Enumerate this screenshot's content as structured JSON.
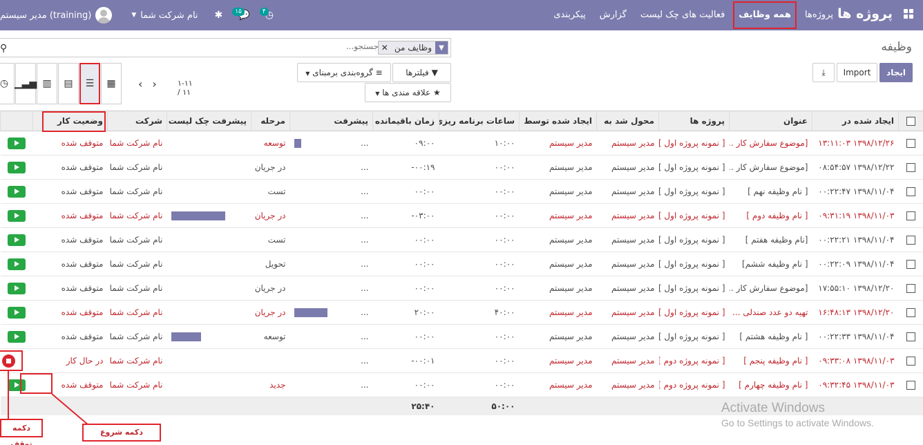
{
  "navbar": {
    "brand": "پروژه ها",
    "menu": [
      "پروژه‌ها",
      "همه وظایف",
      "فعالیت های چک لیست",
      "گزارش",
      "پیکربندی"
    ],
    "user": "مدیر سیستم (training)",
    "company": "نام شرکت شما",
    "activity_count": "۴",
    "message_count": "۱۵"
  },
  "control": {
    "title": "وظیفه",
    "facet": "وظایف من",
    "search_placeholder": "جستجو...",
    "create_label": "ایجاد",
    "import_label": "Import",
    "filters_label": "فیلترها",
    "groupby_label": "گروه‌بندی برمبنای",
    "favorites_label": "علاقه مندی ها",
    "pager": "۱-۱۱ / ۱۱"
  },
  "columns": [
    "ایجاد شده در",
    "عنوان",
    "پروژه ها",
    "محول شد به",
    "ایجاد شده توسط",
    "ساعات برنامه ریزی ...",
    "زمان باقیمانده",
    "پیشرفت",
    "مرحله",
    "پیشرفت چک لیست",
    "شرکت",
    "وضعیت کار"
  ],
  "rows": [
    {
      "red": true,
      "created": "۱۳۹۸/۱۲/۲۶ ۱۳:۱۱:۰۳",
      "name": "[موضوع سفارش کار ...",
      "project": "[ نمونه پروژه اول ]",
      "assigned": "مدیر سیستم",
      "creator": "مدیر سیستم",
      "planned": "۱۰:۰۰",
      "remaining": "۰۹:۰۰",
      "progress": 0.1,
      "dots": "...",
      "stage": "توسعه",
      "checklist": 0,
      "company": "نام شرکت شما",
      "status": "متوقف شده",
      "action": "play"
    },
    {
      "red": false,
      "created": "۱۳۹۸/۱۲/۲۲ ۰۸:۵۴:۵۷",
      "name": "[موضوع سفارش کار ...",
      "project": "[ نمونه پروژه اول ]",
      "assigned": "مدیر سیستم",
      "creator": "مدیر سیستم",
      "planned": "۰۰:۰۰",
      "remaining": "-۰۰:۱۹",
      "progress": 0,
      "dots": "...",
      "stage": "در جریان",
      "checklist": 0,
      "company": "نام شرکت شما",
      "status": "متوقف شده",
      "action": "play"
    },
    {
      "red": false,
      "created": "۱۳۹۸/۱۱/۰۴ ۰۰:۲۲:۴۷",
      "name": "[ نام وظیفه نهم ]",
      "project": "[ نمونه پروژه اول ]",
      "assigned": "مدیر سیستم",
      "creator": "مدیر سیستم",
      "planned": "۰۰:۰۰",
      "remaining": "۰۰:۰۰",
      "progress": 0,
      "dots": "...",
      "stage": "تست",
      "checklist": 0,
      "company": "نام شرکت شما",
      "status": "متوقف شده",
      "action": "play"
    },
    {
      "red": true,
      "created": "۱۳۹۸/۱۱/۰۳ ۰۹:۳۱:۱۹",
      "name": "[ نام وظیفه دوم ]",
      "project": "[ نمونه پروژه اول ]",
      "assigned": "مدیر سیستم",
      "creator": "مدیر سیستم",
      "planned": "۰۰:۰۰",
      "remaining": "-۰۳:۰۰",
      "progress": 0,
      "dots": "...",
      "stage": "در جریان",
      "checklist": 1,
      "company": "نام شرکت شما",
      "status": "متوقف شده",
      "action": "play"
    },
    {
      "red": false,
      "created": "۱۳۹۸/۱۱/۰۴ ۰۰:۲۲:۲۱",
      "name": "[نام وظیفه هفتم ]",
      "project": "[ نمونه پروژه اول ]",
      "assigned": "مدیر سیستم",
      "creator": "مدیر سیستم",
      "planned": "۰۰:۰۰",
      "remaining": "۰۰:۰۰",
      "progress": 0,
      "dots": "...",
      "stage": "تست",
      "checklist": 0,
      "company": "نام شرکت شما",
      "status": "متوقف شده",
      "action": "play"
    },
    {
      "red": false,
      "created": "۱۳۹۸/۱۱/۰۴ ۰۰:۲۲:۰۹",
      "name": "[ نام وظیفه ششم]",
      "project": "[ نمونه پروژه اول ]",
      "assigned": "مدیر سیستم",
      "creator": "مدیر سیستم",
      "planned": "۰۰:۰۰",
      "remaining": "۰۰:۰۰",
      "progress": 0,
      "dots": "...",
      "stage": "تحویل",
      "checklist": 0,
      "company": "نام شرکت شما",
      "status": "متوقف شده",
      "action": "play"
    },
    {
      "red": false,
      "created": "۱۳۹۸/۱۲/۲۰ ۱۷:۵۵:۱۰",
      "name": "[موضوع سفارش کار ...",
      "project": "[ نمونه پروژه اول ]",
      "assigned": "مدیر سیستم",
      "creator": "مدیر سیستم",
      "planned": "۰۰:۰۰",
      "remaining": "۰۰:۰۰",
      "progress": 0,
      "dots": "...",
      "stage": "در جریان",
      "checklist": 0,
      "company": "نام شرکت شما",
      "status": "متوقف شده",
      "action": "play"
    },
    {
      "red": true,
      "created": "۱۳۹۸/۱۲/۲۰ ۱۶:۴۸:۱۳",
      "name": "تهیه دو عدد صندلی ...",
      "project": "[ نمونه پروژه اول ]",
      "assigned": "مدیر سیستم",
      "creator": "مدیر سیستم",
      "planned": "۴۰:۰۰",
      "remaining": "۲۰:۰۰",
      "progress": 0.5,
      "dots": "...",
      "stage": "در جریان",
      "checklist": 0,
      "company": "نام شرکت شما",
      "status": "متوقف شده",
      "action": "play"
    },
    {
      "red": false,
      "created": "۱۳۹۸/۱۱/۰۴ ۰۰:۲۲:۳۳",
      "name": "[ نام وظیفه هشتم ]",
      "project": "[ نمونه پروژه اول ]",
      "assigned": "مدیر سیستم",
      "creator": "مدیر سیستم",
      "planned": "۰۰:۰۰",
      "remaining": "۰۰:۰۰",
      "progress": 0,
      "dots": "...",
      "stage": "توسعه",
      "checklist": 0.55,
      "company": "نام شرکت شما",
      "status": "متوقف شده",
      "action": "play"
    },
    {
      "red": true,
      "created": "۱۳۹۸/۱۱/۰۳ ۰۹:۳۳:۰۸",
      "name": "[ نام وظیفه پنجم ]",
      "project": "[ نمونه پروژه دوم ]",
      "assigned": "مدیر سیستم",
      "creator": "مدیر سیستم",
      "planned": "۰۰:۰۰",
      "remaining": "-۰۰:۰۱",
      "progress": 0,
      "dots": "...",
      "stage": "",
      "checklist": 0,
      "company": "نام شرکت شما",
      "status": "در حال کار",
      "action": "stop"
    },
    {
      "red": true,
      "created": "۱۳۹۸/۱۱/۰۳ ۰۹:۳۲:۴۵",
      "name": "[ نام وظیفه چهارم ]",
      "project": "[ نمونه پروژه دوم ]",
      "assigned": "مدیر سیستم",
      "creator": "مدیر سیستم",
      "planned": "۰۰:۰۰",
      "remaining": "۰۰:۰۰",
      "progress": 0,
      "dots": "...",
      "stage": "جدید",
      "checklist": 0,
      "company": "نام شرکت شما",
      "status": "متوقف شده",
      "action": "play"
    }
  ],
  "totals": {
    "planned": "۵۰:۰۰",
    "remaining": "۲۵:۴۰"
  },
  "annotations": {
    "stop": "دکمه توقف",
    "start": "دکمه شروع"
  },
  "watermark": {
    "line1": "Activate Windows",
    "line2": "Go to Settings to activate Windows."
  },
  "colors": {
    "brand": "#7c7bad",
    "play": "#28a745",
    "stop": "#d9232f",
    "highlight": "#e0242b",
    "overdue": "#c0272d"
  }
}
